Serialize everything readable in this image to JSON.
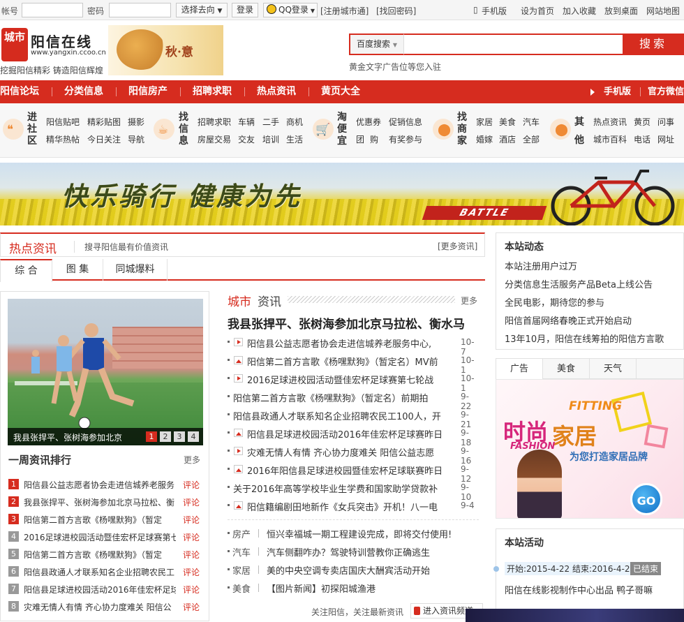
{
  "topbar": {
    "account_label": "帐号",
    "password_label": "密码",
    "account_placeholder": "",
    "password_placeholder": "",
    "goto_select": "选择去向",
    "login_button": "登录",
    "qq_login": "QQ登录",
    "register": "[注册城市通]",
    "find_password": "[找回密码]",
    "mobile": "手机版",
    "set_home": "设为首页",
    "favorite": "加入收藏",
    "desktop": "放到桌面",
    "sitemap": "网站地图"
  },
  "header": {
    "logo_mark": "城市",
    "site_name": "阳信在线",
    "site_url": "www.yangxin.ccoo.cn",
    "slogan": "挖掘阳信精彩 铸造阳信辉煌",
    "season_word": "秋·意",
    "search_category": "百度搜索",
    "search_placeholder": "",
    "search_button": "搜索",
    "ad_text": "黄金文字广告位等您入驻"
  },
  "nav": {
    "items": [
      "阳信论坛",
      "分类信息",
      "阳信房产",
      "招聘求职",
      "热点资讯",
      "黄页大全"
    ],
    "right": [
      "手机版",
      "官方微信"
    ]
  },
  "directory": {
    "groups": [
      {
        "head": "进社区",
        "icon": "speech-bubble-icon",
        "links": [
          "阳信贴吧",
          "精彩贴图",
          "摄影",
          "精华热帖",
          "今日关注",
          "导航"
        ]
      },
      {
        "head": "找信息",
        "icon": "coffee-cup-icon",
        "links": [
          "招聘求职",
          "车辆",
          "二手",
          "商机",
          "房屋交易",
          "交友",
          "培训",
          "生活"
        ]
      },
      {
        "head": "淘便宜",
        "icon": "shopping-cart-icon",
        "links": [
          "优惠券",
          "促销信息",
          "团",
          "购",
          "有奖参与"
        ]
      },
      {
        "head": "找商家",
        "icon": "map-pin-icon",
        "links": [
          "家居",
          "美食",
          "汽车",
          "婚嫁",
          "酒店",
          "全部"
        ]
      },
      {
        "head": "其他",
        "icon": "location-icon",
        "links": [
          "热点资讯",
          "黄页",
          "问事",
          "城市百科",
          "电话",
          "网址"
        ]
      }
    ]
  },
  "banner": {
    "slogan": "快乐骑行 健康为先",
    "brand": "BATTLE"
  },
  "hot": {
    "title": "热点资讯",
    "subtitle": "搜寻阳信最有价值资讯",
    "more": "[更多资讯]",
    "tabs": [
      "综 合",
      "图 集",
      "同城爆料"
    ]
  },
  "slideshow": {
    "caption": "我县张捍平、张树海参加北京",
    "pages": [
      "1",
      "2",
      "3",
      "4"
    ]
  },
  "ranking": {
    "title": "一周资讯排行",
    "more": "更多",
    "comment_label": "评论",
    "items": [
      {
        "num": "1",
        "text": "阳信县公益志愿者协会走进信城养老服务"
      },
      {
        "num": "2",
        "text": "我县张捍平、张树海参加北京马拉松、衡"
      },
      {
        "num": "3",
        "text": "阳信第二首方言歌《杨嘿默狗》（暂定"
      },
      {
        "num": "4",
        "text": "2016足球进校园活动暨佳宏杯足球赛第七"
      },
      {
        "num": "5",
        "text": "阳信第二首方言歌《杨嘿默狗》（暂定"
      },
      {
        "num": "6",
        "text": "阳信县政通人才联系知名企业招聘农民工"
      },
      {
        "num": "7",
        "text": "阳信县足球进校园活动2016年佳宏杯足球"
      },
      {
        "num": "8",
        "text": "灾难无情人有情 齐心协力度难关 阳信公"
      }
    ]
  },
  "city": {
    "title_a": "城市",
    "title_b": "资讯",
    "more": "更多",
    "headline": "我县张捍平、张树海参加北京马拉松、衡水马",
    "news": [
      {
        "icon": "video",
        "text": "阳信县公益志愿者协会走进信城养老服务中心,",
        "date": "10-7"
      },
      {
        "icon": "pic",
        "text": "阳信第二首方言歌《杨嘿默狗》（暂定名）MV前",
        "date": "10-1"
      },
      {
        "icon": "video",
        "text": "2016足球进校园活动暨佳宏杯足球赛第七轮战",
        "date": "10-1"
      },
      {
        "icon": "",
        "text": "阳信第二首方言歌《杨嘿默狗》（暂定名）前期拍",
        "date": "9-22"
      },
      {
        "icon": "",
        "text": "阳信县政通人才联系知名企业招聘农民工100人，开",
        "date": "9-21"
      },
      {
        "icon": "pic",
        "text": "阳信县足球进校园活动2016年佳宏杯足球赛昨日",
        "date": "9-18"
      },
      {
        "icon": "video",
        "text": "灾难无情人有情 齐心协力度难关 阳信公益志愿",
        "date": "9-16"
      },
      {
        "icon": "pic",
        "text": "2016年阳信县足球进校园暨佳宏杯足球联赛昨日",
        "date": "9-12"
      },
      {
        "icon": "",
        "text": "关于2016年高等学校毕业生学费和国家助学贷款补",
        "date": "9-10"
      },
      {
        "icon": "pic",
        "text": "阳信籍编剧田地新作《女兵突击》开机！八一电",
        "date": "9-4"
      }
    ],
    "categories": [
      {
        "k": "房产",
        "t": "恒兴幸福城一期工程建设完成，即将交付使用!"
      },
      {
        "k": "汽车",
        "t": "汽车侧翻咋办？驾驶特训营教你正确逃生"
      },
      {
        "k": "家居",
        "t": "美的中央空调专卖店国庆大酬宾活动开始"
      },
      {
        "k": "美食",
        "t": "【图片新闻】初探阳城渔港"
      }
    ],
    "follow_text": "关注阳信，关注最新资讯",
    "follow_button": "进入资讯频道"
  },
  "site_news": {
    "title": "本站动态",
    "items": [
      "本站注册用户过万",
      "分类信息生活服务产品Beta上线公告",
      "全民电影，期待您的参与",
      "阳信首届网络春晚正式开始启动",
      "13年10月，阳信在线筹拍的阳信方言歌"
    ]
  },
  "ad_tabs": [
    "广告",
    "美食",
    "天气"
  ],
  "fashion_ad": {
    "big1": "时尚",
    "big2": "家居",
    "en1": "FITTING",
    "en2": "FASHION",
    "sub": "为您打造家居品牌",
    "go": "GO"
  },
  "activity": {
    "title": "本站活动",
    "time": "开始:2015-4-22 结束:2016-4-22",
    "tag": "已结束",
    "item": "阳信在线影视制作中心出品 鸭子哥嘛"
  }
}
